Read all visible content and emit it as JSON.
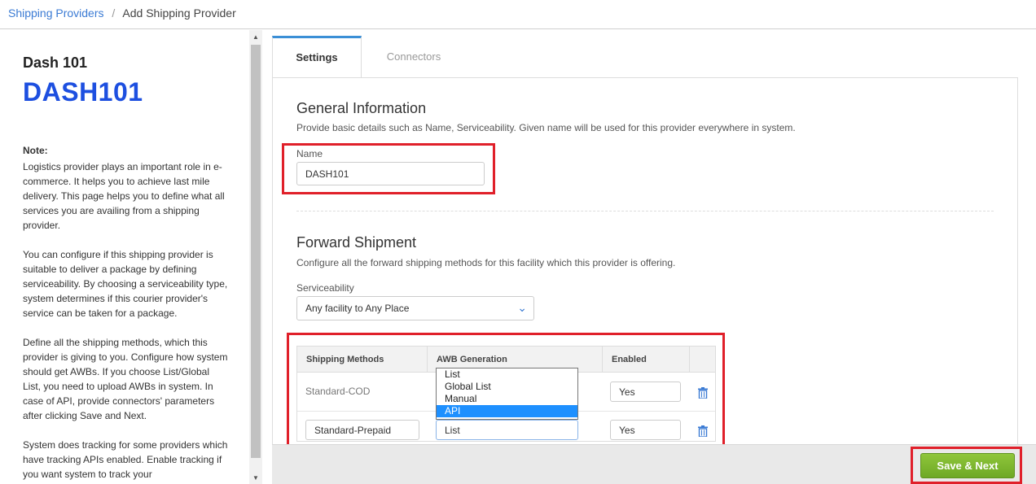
{
  "breadcrumb": {
    "parent": "Shipping Providers",
    "separator": "/",
    "current": "Add Shipping Provider"
  },
  "sidebar": {
    "provider_name": "Dash 101",
    "provider_code": "DASH101",
    "note_heading": "Note:",
    "note_paragraphs": [
      "Logistics provider plays an important role in e-commerce. It helps you to achieve last mile delivery. This page helps you to define what all services you are availing from a shipping provider.",
      "You can configure if this shipping provider is suitable to deliver a package by defining serviceability. By choosing a serviceability type, system determines if this courier provider's service can be taken for a package.",
      "Define all the shipping methods, which this provider is giving to you. Configure how system should get AWBs. If you choose List/Global List, you need to upload AWBs in system. In case of API, provide connectors' parameters after clicking Save and Next.",
      "System does tracking for some providers which have tracking APIs enabled. Enable tracking if you want system to track your"
    ]
  },
  "tabs": {
    "settings": "Settings",
    "connectors": "Connectors"
  },
  "general": {
    "title": "General Information",
    "desc": "Provide basic details such as Name, Serviceability. Given name will be used for this provider everywhere in system.",
    "name_label": "Name",
    "name_value": "DASH101"
  },
  "forward": {
    "title": "Forward Shipment",
    "desc": "Configure all the forward shipping methods for this facility which this provider is offering.",
    "serviceability_label": "Serviceability",
    "serviceability_value": "Any facility to Any Place"
  },
  "table": {
    "headers": [
      "Shipping Methods",
      "AWB Generation",
      "Enabled"
    ],
    "rows": [
      {
        "method": "Standard-COD",
        "awb": "",
        "enabled": "Yes"
      },
      {
        "method": "Standard-Prepaid",
        "awb": "List",
        "enabled": "Yes"
      }
    ]
  },
  "awb_dropdown": {
    "options": [
      "List",
      "Global List",
      "Manual",
      "API"
    ],
    "highlighted": "API"
  },
  "footer": {
    "save_label": "Save & Next"
  },
  "colors": {
    "link": "#3b7bd4",
    "code": "#1d4fe0",
    "highlight": "#e0202a",
    "save": "#7cb82f",
    "selected_option": "#1e90ff"
  }
}
